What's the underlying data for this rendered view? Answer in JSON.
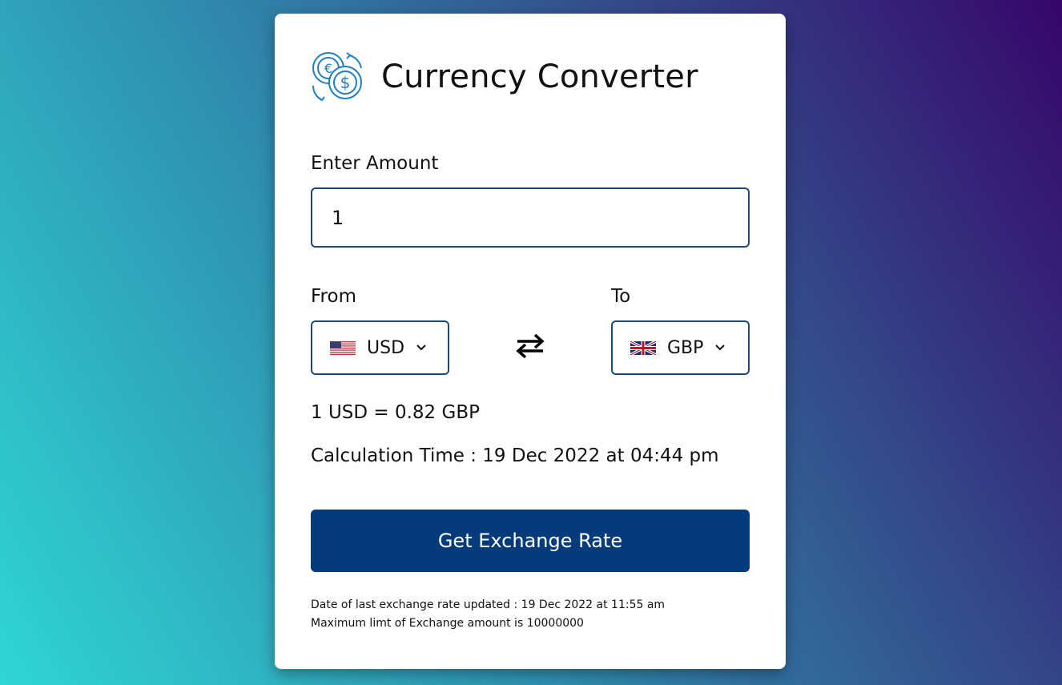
{
  "app": {
    "title": "Currency Converter",
    "logo_icon": "currency-exchange-icon"
  },
  "amount": {
    "label": "Enter Amount",
    "value": "1"
  },
  "from": {
    "label": "From",
    "currency": "USD",
    "flag_icon": "us-flag-icon"
  },
  "to": {
    "label": "To",
    "currency": "GBP",
    "flag_icon": "uk-flag-icon"
  },
  "swap_icon": "swap-arrows-icon",
  "result": {
    "rate_text": "1 USD = 0.82 GBP",
    "calculation_time": "Calculation Time : 19 Dec 2022 at 04:44 pm"
  },
  "button": {
    "label": "Get Exchange Rate"
  },
  "notes": {
    "last_updated": "Date of last exchange rate updated : 19 Dec 2022 at 11:55 am",
    "max_limit": "Maximum limt of Exchange amount is 10000000"
  },
  "colors": {
    "accent": "#053b7b",
    "border": "#1b4a7a",
    "icon_blue": "#1f7fc0"
  }
}
